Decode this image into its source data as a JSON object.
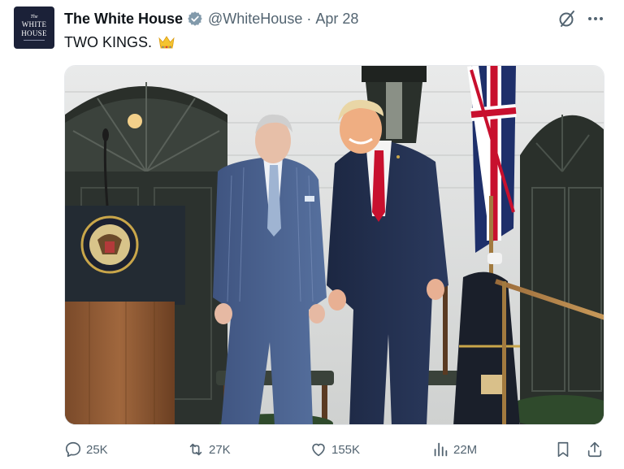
{
  "account": {
    "avatar_line1": "The",
    "avatar_line2": "WHITE",
    "avatar_line3": "HOUSE",
    "display_name": "The White House",
    "handle": "@WhiteHouse",
    "separator": "·",
    "date": "Apr 28"
  },
  "post": {
    "text": "TWO KINGS.",
    "emoji": "crown-emoji"
  },
  "metrics": {
    "replies": "25K",
    "reposts": "27K",
    "likes": "155K",
    "views": "22M"
  },
  "colors": {
    "secondary_text": "#536471",
    "primary_text": "#0f1419",
    "gov_badge": "#829aab",
    "avatar_bg": "#1b2138"
  },
  "icons": {
    "verified": "gray-verified-badge-icon",
    "grok": "grok-icon",
    "more": "more-dots-icon",
    "reply": "reply-icon",
    "retweet": "retweet-icon",
    "like": "heart-icon",
    "views": "views-chart-icon",
    "bookmark": "bookmark-icon",
    "share": "share-icon"
  }
}
